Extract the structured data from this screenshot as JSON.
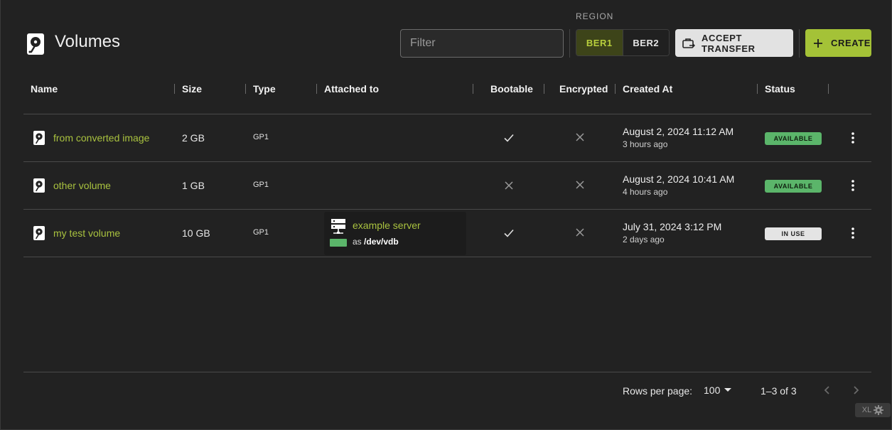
{
  "header": {
    "title": "Volumes",
    "icon": "harddisk-icon",
    "filter_placeholder": "Filter",
    "region_label": "REGION",
    "regions": [
      "BER1",
      "BER2"
    ],
    "selected_region": "BER1",
    "accept_transfer_label": "ACCEPT TRANSFER",
    "create_label": "CREATE",
    "accent_color": "#a4c237"
  },
  "table": {
    "columns": [
      "Name",
      "Size",
      "Type",
      "Attached to",
      "Bootable",
      "Encrypted",
      "Created At",
      "Status"
    ],
    "rows": [
      {
        "name": "from converted image",
        "size": "2 GB",
        "type": "GP1",
        "attached": null,
        "bootable": true,
        "encrypted": false,
        "created_at": "August 2, 2024 11:12 AM",
        "created_ago": "3 hours ago",
        "status": "AVAILABLE"
      },
      {
        "name": "other volume",
        "size": "1 GB",
        "type": "GP1",
        "attached": null,
        "bootable": false,
        "encrypted": false,
        "created_at": "August 2, 2024 10:41 AM",
        "created_ago": "4 hours ago",
        "status": "AVAILABLE"
      },
      {
        "name": "my test volume",
        "size": "10 GB",
        "type": "GP1",
        "attached": {
          "server": "example server",
          "as_prefix": "as",
          "device": "/dev/vdb"
        },
        "bootable": true,
        "encrypted": false,
        "created_at": "July 31, 2024 3:12 PM",
        "created_ago": "2 days ago",
        "status": "IN USE"
      }
    ]
  },
  "footer": {
    "rows_per_page_label": "Rows per page:",
    "rows_per_page_value": "100",
    "range_text": "1–3 of 3"
  },
  "badge": {
    "label": "XL",
    "icon": "gear-icon"
  },
  "colors": {
    "link": "#a9c23f",
    "available": "#5bb56a",
    "in_use": "#e4e4e4",
    "background": "#222222"
  }
}
